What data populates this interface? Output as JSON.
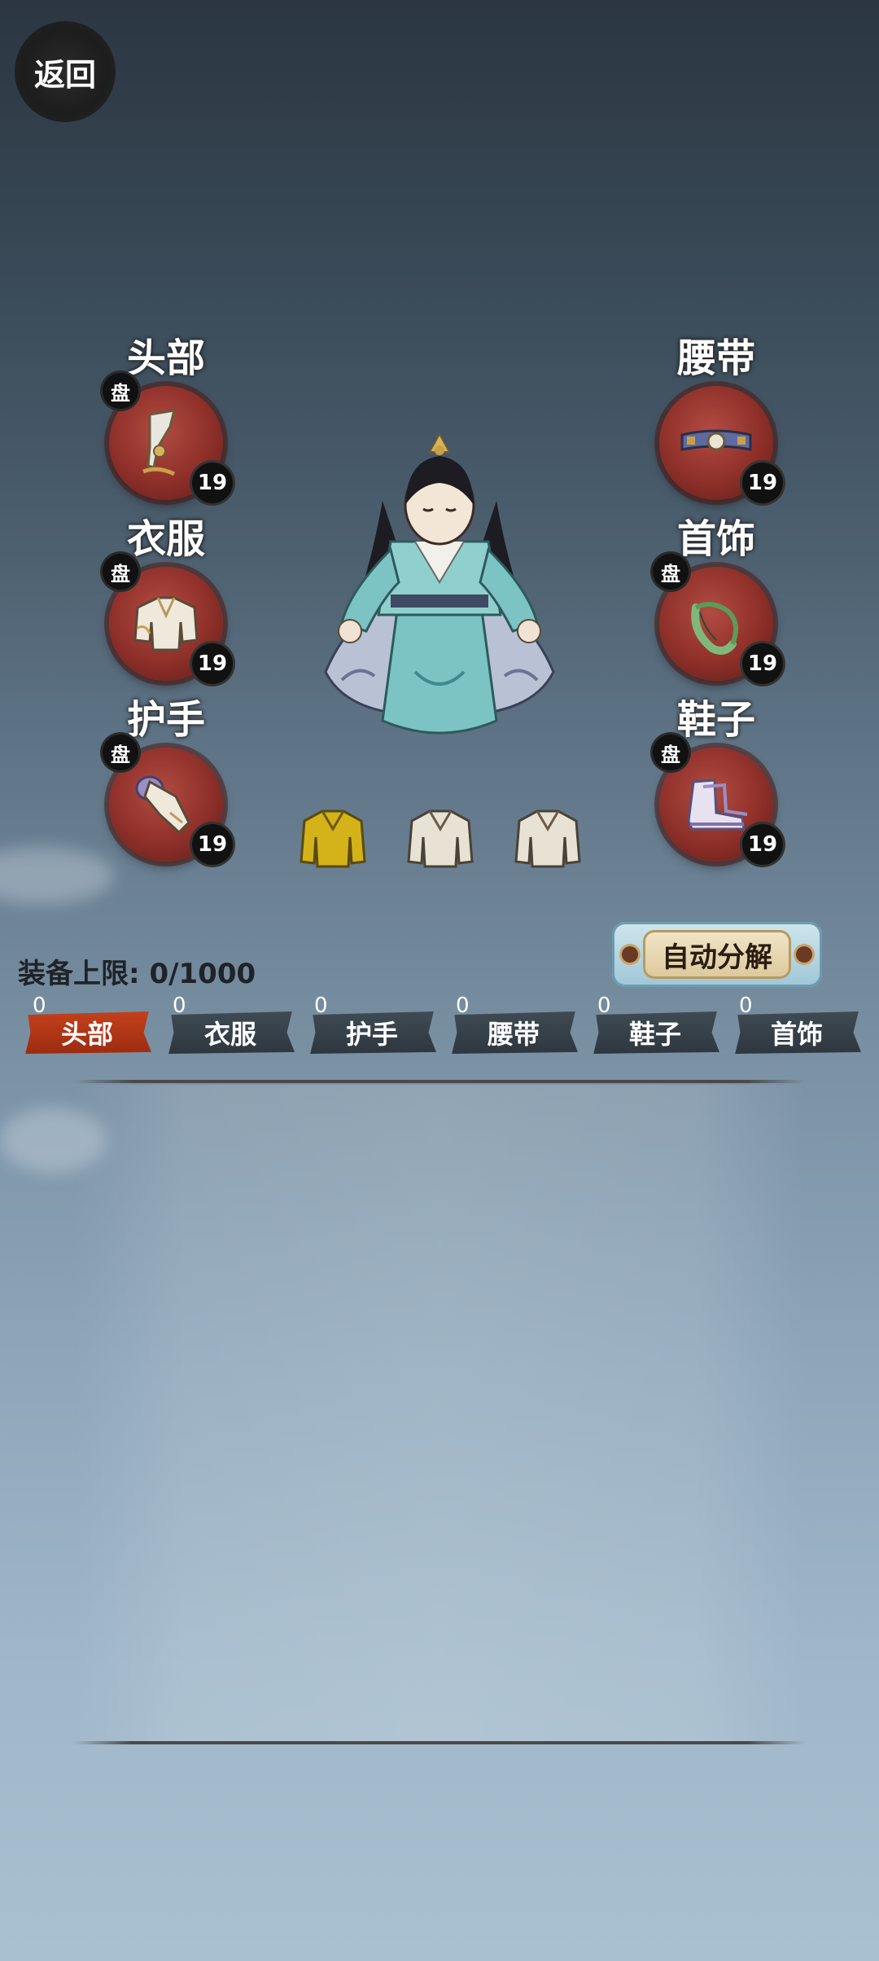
{
  "header": {
    "back_label": "返回"
  },
  "slots": [
    {
      "id": "head",
      "label": "头部",
      "badge": "盘",
      "level": "19"
    },
    {
      "id": "clothes",
      "label": "衣服",
      "badge": "盘",
      "level": "19"
    },
    {
      "id": "gloves",
      "label": "护手",
      "badge": "盘",
      "level": "19"
    },
    {
      "id": "belt",
      "label": "腰带",
      "badge": "",
      "level": "19"
    },
    {
      "id": "necklace",
      "label": "首饰",
      "badge": "盘",
      "level": "19"
    },
    {
      "id": "shoes",
      "label": "鞋子",
      "badge": "盘",
      "level": "19"
    }
  ],
  "inventory": {
    "capacity_label": "装备上限:",
    "capacity_value": "0/1000",
    "auto_decompose_label": "自动分解"
  },
  "tabs": [
    {
      "label": "头部",
      "count": "0",
      "active": true
    },
    {
      "label": "衣服",
      "count": "0",
      "active": false
    },
    {
      "label": "护手",
      "count": "0",
      "active": false
    },
    {
      "label": "腰带",
      "count": "0",
      "active": false
    },
    {
      "label": "鞋子",
      "count": "0",
      "active": false
    },
    {
      "label": "首饰",
      "count": "0",
      "active": false
    }
  ],
  "colors": {
    "slot_red": "#8e2f29",
    "tab_active": "#c3401c",
    "tab_inactive": "#3f4a53",
    "robe_gold": "#d4b21a",
    "robe_white": "#e8e2d4"
  }
}
